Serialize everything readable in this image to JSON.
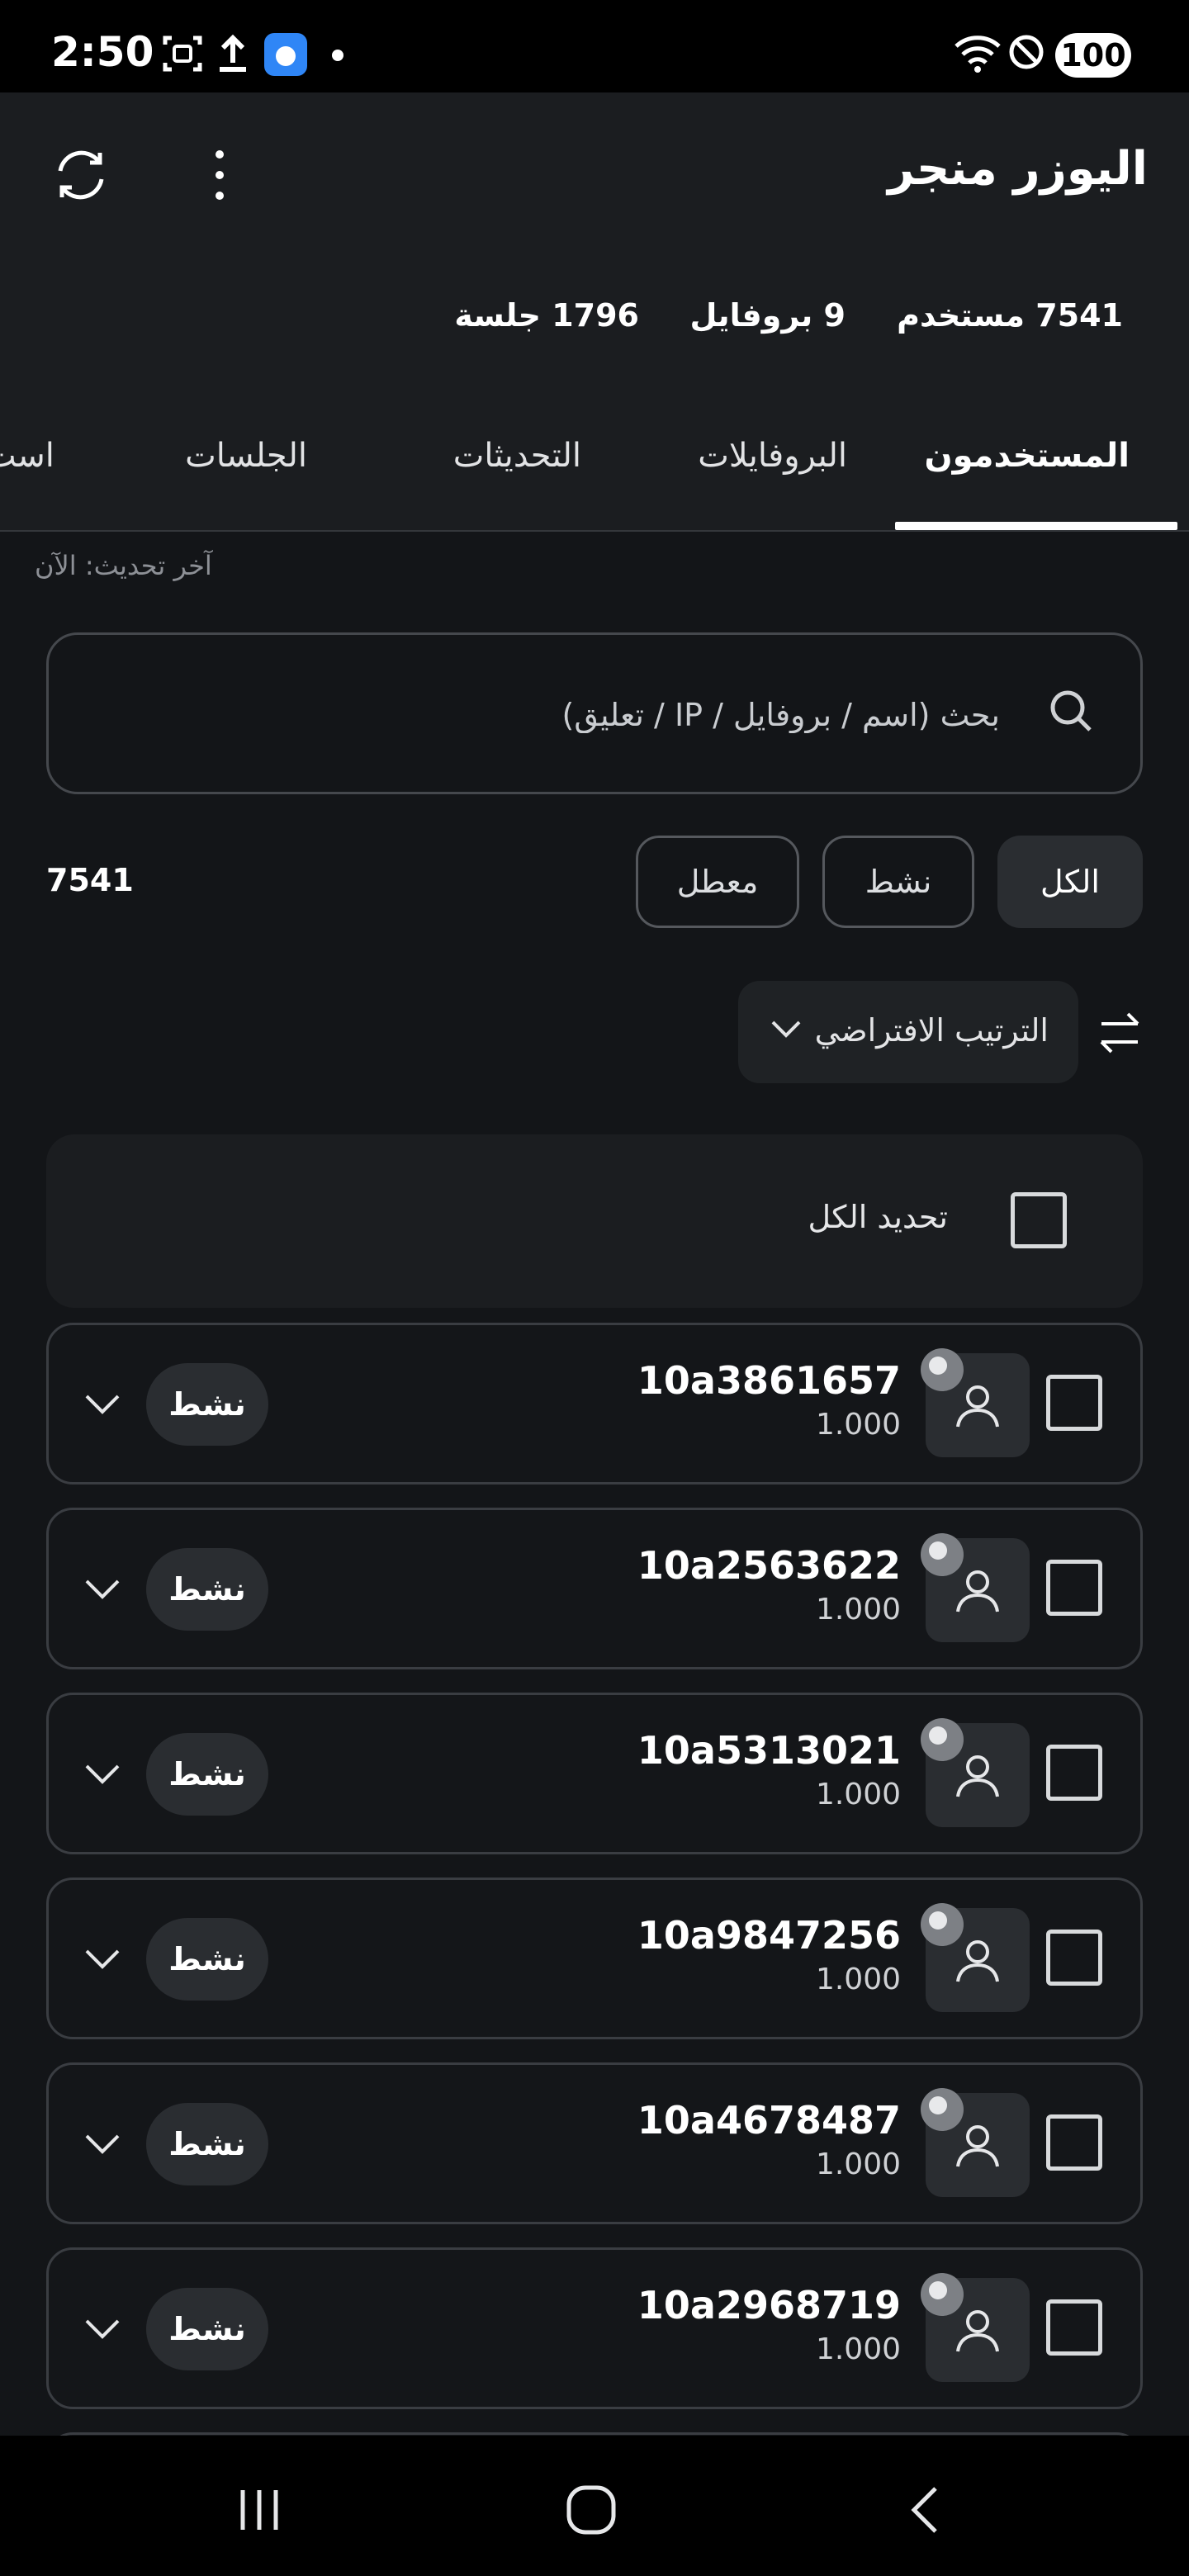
{
  "status_bar": {
    "time": "2:50",
    "battery": "100",
    "icons": [
      "screenshot-icon",
      "upload-icon",
      "app-notification-icon",
      "dot-icon",
      "wifi-icon",
      "do-not-disturb-icon"
    ]
  },
  "app": {
    "title": "اليوزر منجر",
    "stats": {
      "users": "7541 مستخدم",
      "profiles": "9 بروفايل",
      "sessions": "1796 جلسة"
    }
  },
  "tabs": [
    {
      "label": "المستخدمون",
      "active": true
    },
    {
      "label": "البروفايلات",
      "active": false
    },
    {
      "label": "التحديثات",
      "active": false
    },
    {
      "label": "الجلسات",
      "active": false
    },
    {
      "label": "است",
      "active": false
    }
  ],
  "last_update": "آخر تحديث: الآن",
  "search": {
    "placeholder": "بحث (اسم / بروفايل / IP / تعليق)"
  },
  "filters": {
    "all": "الكل",
    "active": "نشط",
    "disabled": "معطل",
    "count": "7541"
  },
  "sort": {
    "label": "الترتيب الافتراضي"
  },
  "select_all": "تحديد الكل",
  "users": [
    {
      "name": "10a3861657",
      "value": "1.000",
      "status": "نشط"
    },
    {
      "name": "10a2563622",
      "value": "1.000",
      "status": "نشط"
    },
    {
      "name": "10a5313021",
      "value": "1.000",
      "status": "نشط"
    },
    {
      "name": "10a9847256",
      "value": "1.000",
      "status": "نشط"
    },
    {
      "name": "10a4678487",
      "value": "1.000",
      "status": "نشط"
    },
    {
      "name": "10a2968719",
      "value": "1.000",
      "status": "نشط"
    }
  ]
}
